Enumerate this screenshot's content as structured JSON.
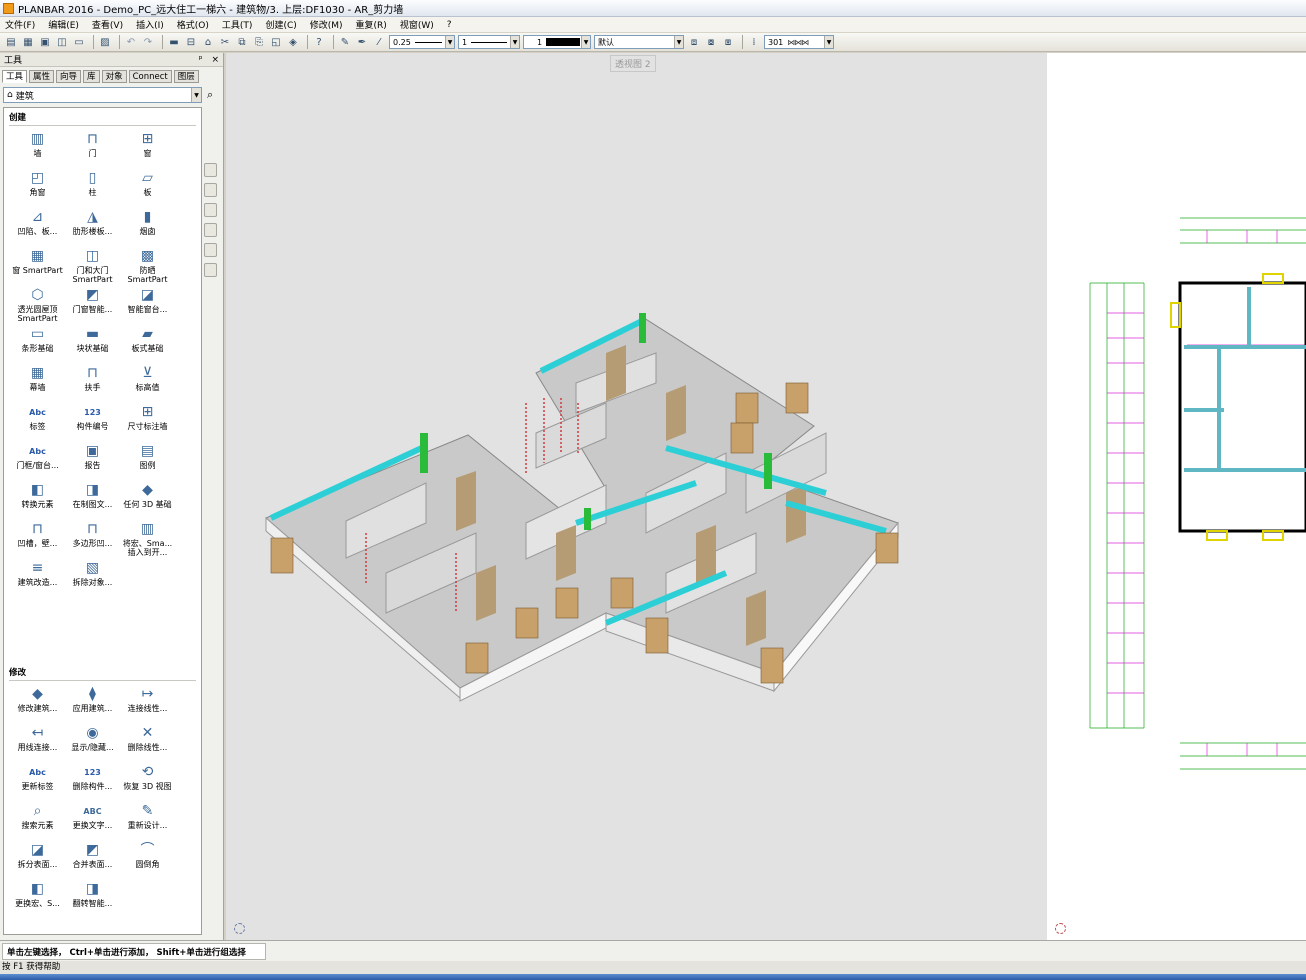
{
  "window": {
    "title": "PLANBAR 2016 - Demo_PC_远大住工一梯六 - 建筑物/3. 上层:DF1030 - AR_剪力墙"
  },
  "menu": [
    "文件(F)",
    "编辑(E)",
    "查看(V)",
    "插入(I)",
    "格式(O)",
    "工具(T)",
    "创建(C)",
    "修改(M)",
    "重复(R)",
    "视窗(W)",
    "?"
  ],
  "toolbar": {
    "pen": "0.25",
    "line": "1",
    "color": "1",
    "layer": "默认",
    "hatch": "301"
  },
  "panel": {
    "title": "工具",
    "pin": "ᵖ",
    "close": "×",
    "tabs": [
      "工具",
      "属性",
      "向导",
      "库",
      "对象",
      "Connect",
      "图层"
    ],
    "category": "建筑",
    "create_heading": "创建",
    "modify_heading": "修改",
    "create_tools": [
      "墙",
      "门",
      "窗",
      "角窗",
      "柱",
      "板",
      "凹陷、板...",
      "肋形楼板...",
      "烟囱",
      "窗 SmartPart",
      "门和大门 SmartPart",
      "防晒 SmartPart",
      "透光圆屋顶 SmartPart",
      "门窗智能...",
      "智能窗台...",
      "条形基础",
      "块状基础",
      "板式基础",
      "幕墙",
      "扶手",
      "标高值",
      "标签",
      "构件编号",
      "尺寸标注墙",
      "门框/窗台...",
      "报告",
      "图例",
      "转换元素",
      "在制图文...",
      "任何 3D 基础",
      "凹槽，壁...",
      "多边形凹...",
      "将宏、Sma... 插入到开...",
      "建筑改造...",
      "拆除对象..."
    ],
    "modify_tools": [
      "修改建筑...",
      "应用建筑...",
      "连接线性...",
      "用线连接...",
      "显示/隐藏...",
      "删除线性...",
      "更新标签",
      "删除构件...",
      "恢复 3D 视图",
      "搜索元素",
      "更换文字...",
      "重新设计...",
      "拆分表面...",
      "合并表面...",
      "圆倒角",
      "更换宏、S...",
      "翻转智能..."
    ]
  },
  "viewport": {
    "label": "透视图 2"
  },
  "status": {
    "prompt": "单击左键选择， Ctrl+单击进行添加， Shift+单击进行组选择",
    "help": "按 F1 获得帮助"
  }
}
